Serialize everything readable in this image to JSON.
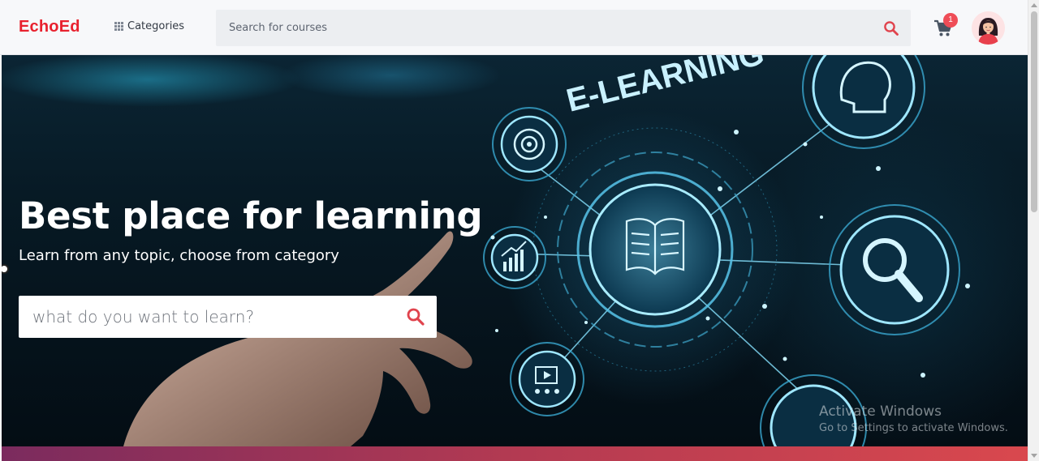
{
  "header": {
    "logo": "EchoEd",
    "categories_label": "Categories",
    "search_placeholder": "Search for courses",
    "cart_count": "1"
  },
  "hero": {
    "title": "Best place for learning",
    "subtitle": "Learn from any topic, choose from category",
    "search_placeholder": "what do you want to learn?",
    "image_text": "E-LEARNING"
  },
  "watermark": {
    "title": "Activate Windows",
    "subtitle": "Go to Settings to activate Windows."
  },
  "colors": {
    "brand": "#e8212e",
    "badge": "#ef4d57",
    "search_icon": "#e0434d"
  },
  "icons": [
    "grid-icon",
    "search-icon",
    "cart-icon",
    "avatar",
    "book-icon",
    "magnifier-icon",
    "target-icon",
    "chart-icon",
    "video-icon",
    "head-icon"
  ]
}
